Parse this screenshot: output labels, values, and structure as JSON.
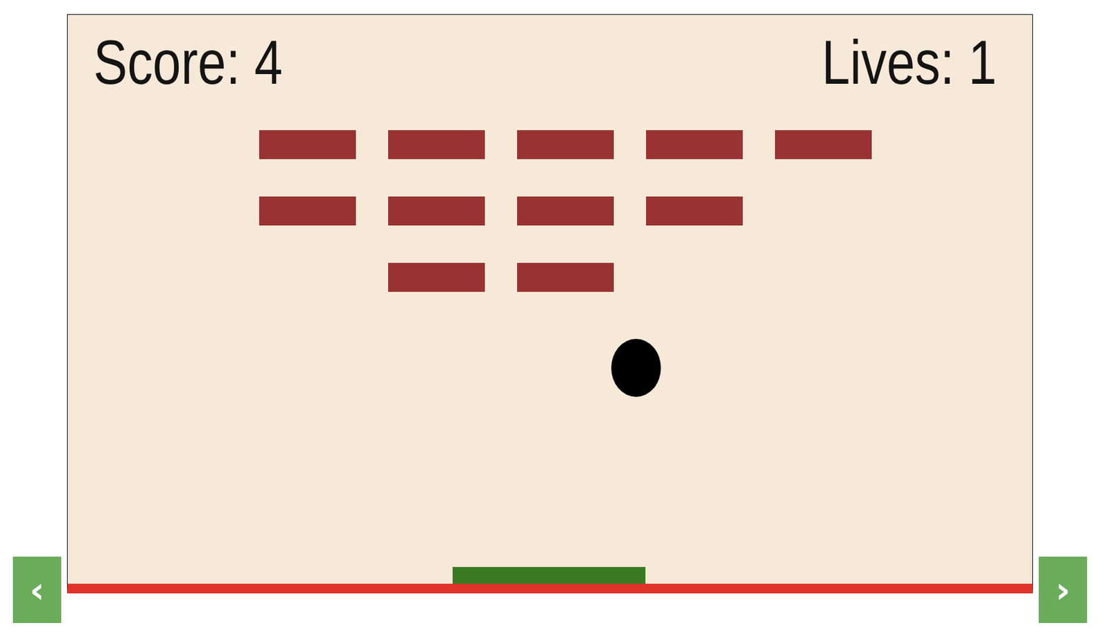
{
  "hud": {
    "score": "Score: 4",
    "lives": "Lives: 1"
  },
  "bricks": [
    [
      {
        "broken": false
      },
      {
        "broken": false
      },
      {
        "broken": false
      },
      {
        "broken": false
      },
      {
        "broken": false
      }
    ],
    [
      {
        "broken": false
      },
      {
        "broken": false
      },
      {
        "broken": false
      },
      {
        "broken": false
      },
      {
        "broken": true
      }
    ],
    [
      {
        "broken": true
      },
      {
        "broken": false
      },
      {
        "broken": false
      },
      {
        "broken": true
      },
      {
        "broken": true
      }
    ]
  ],
  "nav": {
    "prev": "‹",
    "next": "›"
  }
}
